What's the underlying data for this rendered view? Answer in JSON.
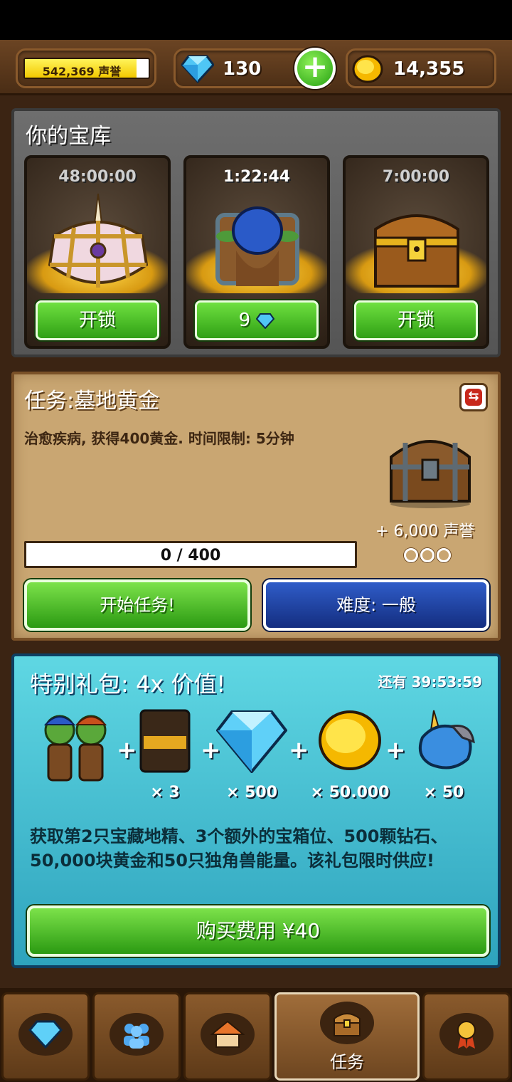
{
  "header": {
    "reputation": {
      "value": "542,369 声誉",
      "fill_fraction": 0.9
    },
    "gems": "130",
    "gold": "14,355"
  },
  "vault": {
    "title": "你的宝库",
    "slots": [
      {
        "timer": "48:00:00",
        "button": "开锁",
        "chest": "unicorn-chest-icon"
      },
      {
        "timer": "1:22:44",
        "button": "9",
        "button_icon": "gem-icon",
        "chest": "goblin-opening-chest-icon"
      },
      {
        "timer": "7:00:00",
        "button": "开锁",
        "chest": "gold-chest-icon"
      }
    ]
  },
  "mission": {
    "title": "任务:墓地黄金",
    "description": "治愈疾病, 获得400黄金. 时间限制: 5分钟",
    "reward": "+ 6,000 声誉",
    "progress_text": "0 / 400",
    "progress_fraction": 0,
    "difficulty_dots": [
      false,
      false,
      false
    ],
    "start_button": "开始任务!",
    "difficulty_button": "难度: 一般"
  },
  "special": {
    "title": "特别礼包: 4x 价值!",
    "timer": "还有 39:53:59",
    "items": [
      {
        "icon": "goblins-icon",
        "qty": ""
      },
      {
        "icon": "chest-slot-card-icon",
        "qty": "× 3"
      },
      {
        "icon": "diamond-icon",
        "qty": "× 500"
      },
      {
        "icon": "gold-coin-icon",
        "qty": "× 50.000"
      },
      {
        "icon": "unicorn-icon",
        "qty": "× 50"
      }
    ],
    "plus": "+",
    "description": "获取第2只宝藏地精、3个额外的宝箱位、500颗钻石、50,000块黄金和50只独角兽能量。该礼包限时供应!",
    "buy_button": "购买费用 ¥40"
  },
  "nav": {
    "tabs": [
      {
        "icon": "gem-icon",
        "label": ""
      },
      {
        "icon": "people-icon",
        "label": ""
      },
      {
        "icon": "house-icon",
        "label": ""
      },
      {
        "icon": "chest-icon",
        "label": "任务",
        "active": true
      },
      {
        "icon": "medal-icon",
        "label": ""
      }
    ]
  }
}
